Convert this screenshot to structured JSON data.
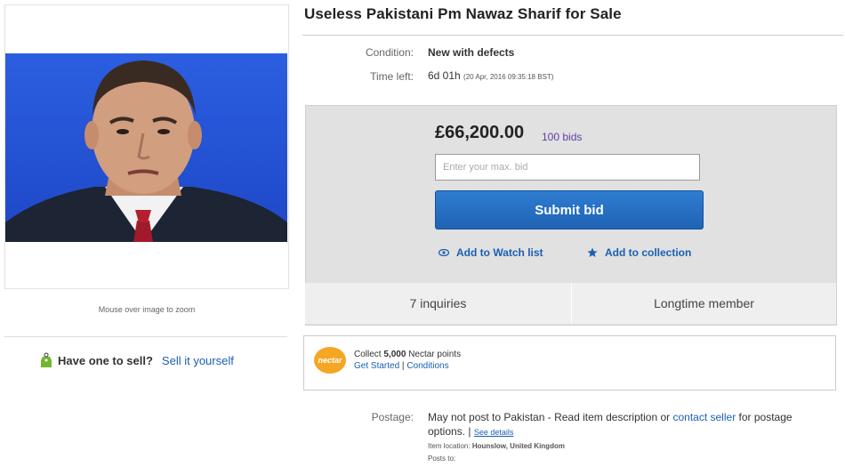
{
  "listing": {
    "title": "Useless Pakistani Pm Nawaz Sharif for Sale",
    "condition_label": "Condition:",
    "condition_value": "New with defects",
    "time_left_label": "Time left:",
    "time_left_value": "6d 01h",
    "end_time": "(20 Apr, 2016   09:35:18 BST)"
  },
  "image": {
    "zoom_hint": "Mouse over image to zoom"
  },
  "sell": {
    "question": "Have one to sell?",
    "link": "Sell it yourself"
  },
  "bid": {
    "price": "£66,200.00",
    "bids": "100 bids",
    "input_placeholder": "Enter your max. bid",
    "submit_label": "Submit bid",
    "watch_label": "Add to Watch list",
    "collection_label": "Add to collection"
  },
  "stats": {
    "inquiries": "7 inquiries",
    "member": "Longtime member"
  },
  "nectar": {
    "logo_text": "nectar",
    "collect_prefix": "Collect",
    "points": "5,000",
    "collect_suffix": "Nectar points",
    "get_started": "Get Started",
    "separator": "|",
    "conditions": "Conditions"
  },
  "postage": {
    "label": "Postage:",
    "text_before": "May not post to Pakistan - Read item description or",
    "contact_link": "contact seller",
    "text_after": "for postage options.",
    "separator": "|",
    "see_details": "See details",
    "item_location_label": "Item location:",
    "item_location_value": "Hounslow, United Kingdom",
    "posts_to_label": "Posts to:"
  },
  "colors": {
    "accent": "#1f63b4",
    "link": "#1a5fb4",
    "bids": "#5b3ea8",
    "nectar": "#f5a623"
  }
}
